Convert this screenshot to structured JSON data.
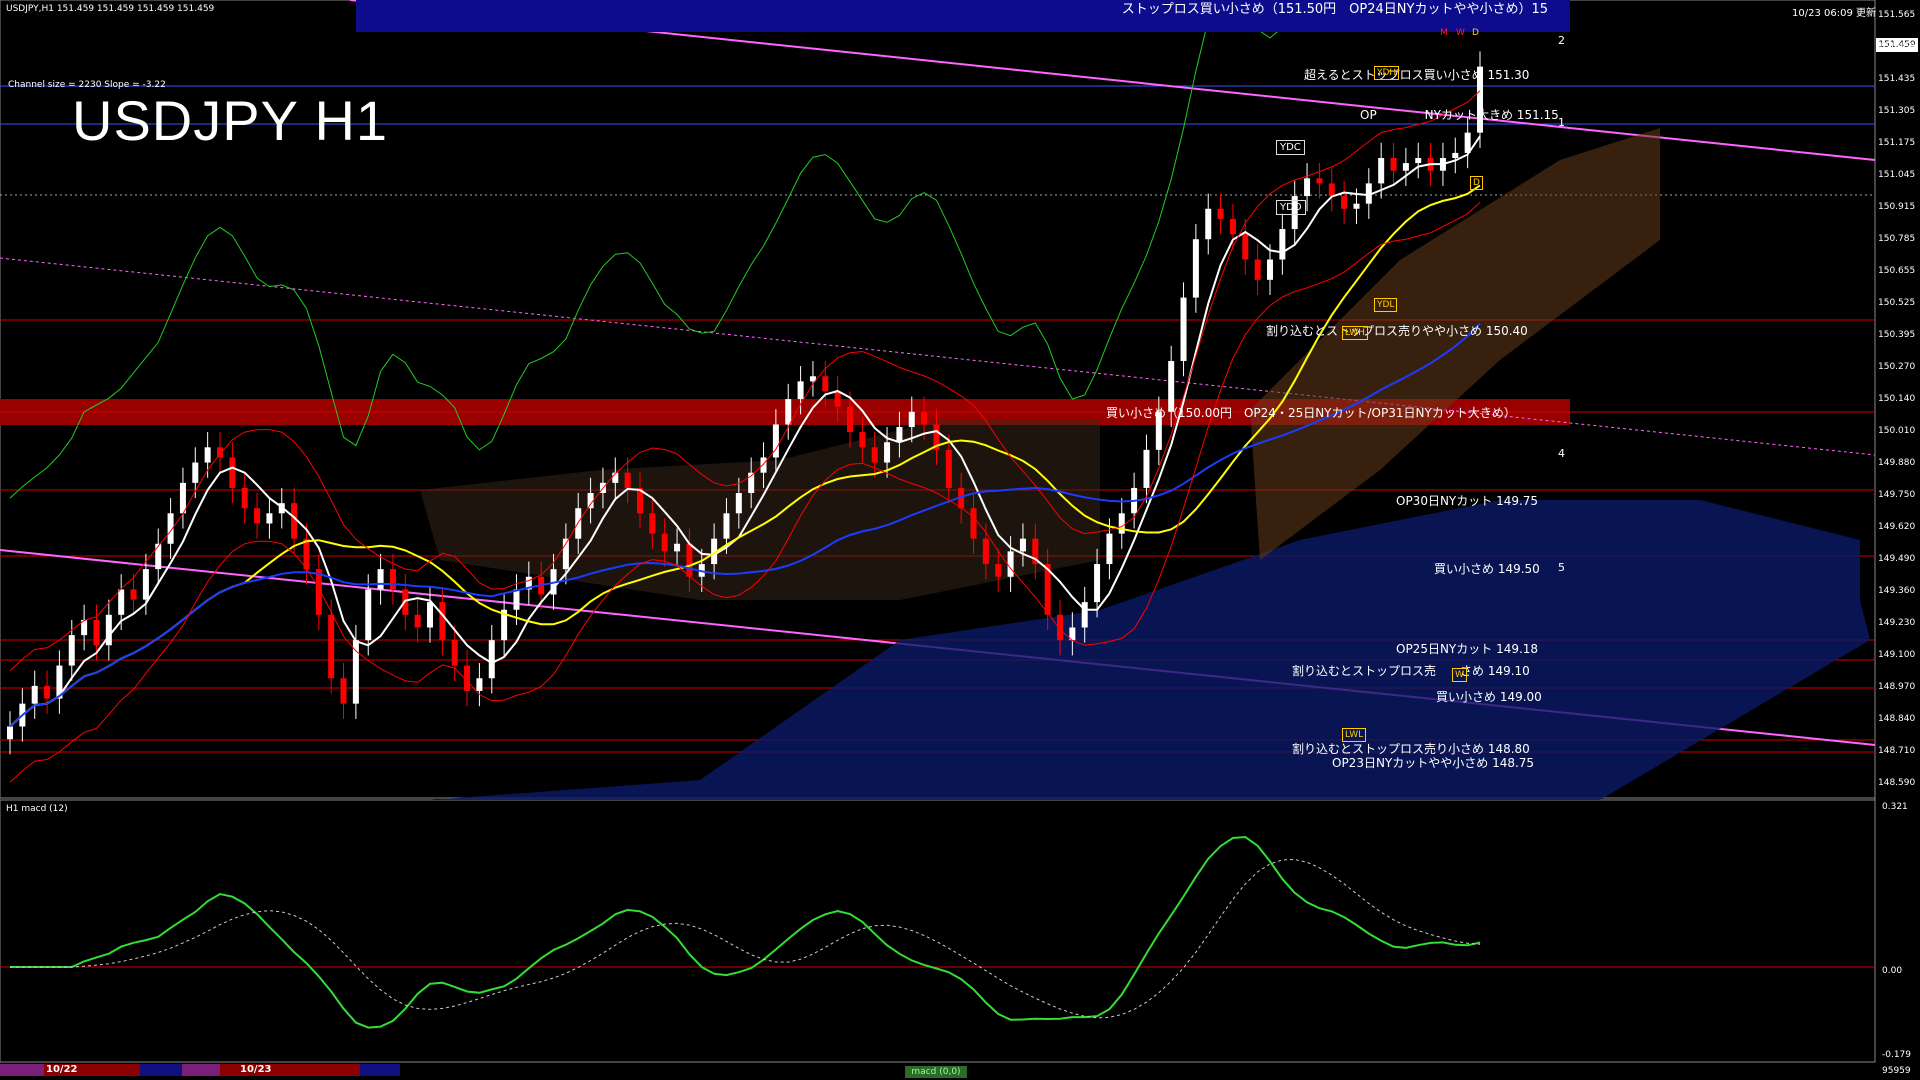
{
  "header": {
    "ohlc": "USDJPY,H1  151.459 151.459 151.459 151.459",
    "channel_info": "Channel size = 2230 Slope = -3.22",
    "big_title": "USDJPY H1",
    "timestamp": "10/23 06:09 更新"
  },
  "banner": {
    "text": "ストップロス買い小さめ（151.50円　OP24日NYカットやや小さめ）15"
  },
  "price_box": "151.459",
  "levels": [
    {
      "label": "超えるとストップロス買い小さめ 151.30"
    },
    {
      "label": "OP　　　　NYカット大きめ 151.15"
    },
    {
      "label": "割り込むとストップロス売りやや小さめ 150.40"
    },
    {
      "label": "買い小さめ（150.00円　OP24・25日NYカット/OP31日NYカット大きめ）"
    },
    {
      "label": "OP30日NYカット 149.75"
    },
    {
      "label": "買い小さめ 149.50"
    },
    {
      "label": "OP25日NYカット 149.18"
    },
    {
      "label": "割り込むとストップロス売　　さめ 149.10"
    },
    {
      "label": "買い小さめ 149.00"
    },
    {
      "label": "割り込むとストップロス売り小さめ 148.80"
    },
    {
      "label": "OP23日NYカットやや小さめ 148.75"
    }
  ],
  "yaxis_main": [
    "151.565",
    "151.459",
    "151.435",
    "151.305",
    "151.175",
    "151.045",
    "150.915",
    "150.785",
    "150.655",
    "150.525",
    "150.395",
    "150.270",
    "150.140",
    "150.010",
    "149.880",
    "149.750",
    "149.620",
    "149.490",
    "149.360",
    "149.230",
    "149.100",
    "148.970",
    "148.840",
    "148.710",
    "148.590"
  ],
  "yaxis_macd": [
    "0.321",
    "0.00",
    "-0.179",
    "95959"
  ],
  "macd_label": "H1 macd (12)",
  "wave_numbers": [
    "2",
    "1",
    "4",
    "5",
    "15"
  ],
  "box_labels": {
    "ydc1": "YDC",
    "ydc2": "YDO",
    "ydh": "YDH",
    "ydl": "YDL",
    "lwh": "LWH",
    "lwl": "LWL",
    "m": "M",
    "w": "W",
    "d": "D",
    "d2": "D",
    "w2": "W"
  },
  "dates": [
    "10/22",
    "10/23"
  ],
  "tabs": {
    "macd": "macd (0,0)"
  },
  "colors": {
    "bg": "#000000",
    "bull": "#ffffff",
    "bear": "#ff0000",
    "sma_white": "#ffffff",
    "sma_yellow": "#ffff00",
    "sma_blue": "#1a3cff",
    "green": "#22cc22",
    "magenta": "#ff66ff",
    "level_red": "#d00000",
    "banner_blue": "#0c0c8c",
    "band_red": "#990000"
  },
  "chart_data": {
    "type": "candlestick",
    "title": "USDJPY H1",
    "ylim": [
      148.59,
      151.565
    ],
    "candles_close": [
      148.86,
      148.95,
      149.02,
      148.97,
      149.1,
      149.22,
      149.28,
      149.18,
      149.3,
      149.4,
      149.36,
      149.48,
      149.58,
      149.7,
      149.82,
      149.9,
      149.96,
      149.92,
      149.8,
      149.72,
      149.66,
      149.7,
      149.74,
      149.6,
      149.48,
      149.3,
      149.05,
      148.95,
      149.2,
      149.4,
      149.48,
      149.4,
      149.3,
      149.25,
      149.35,
      149.2,
      149.1,
      149.0,
      149.05,
      149.2,
      149.32,
      149.4,
      149.45,
      149.38,
      149.48,
      149.6,
      149.72,
      149.78,
      149.82,
      149.86,
      149.8,
      149.7,
      149.62,
      149.55,
      149.58,
      149.45,
      149.5,
      149.6,
      149.7,
      149.78,
      149.86,
      149.92,
      150.05,
      150.15,
      150.22,
      150.24,
      150.18,
      150.12,
      150.02,
      149.96,
      149.9,
      149.98,
      150.04,
      150.1,
      150.05,
      149.95,
      149.8,
      149.72,
      149.6,
      149.5,
      149.45,
      149.55,
      149.6,
      149.5,
      149.3,
      149.2,
      149.25,
      149.35,
      149.5,
      149.62,
      149.7,
      149.8,
      149.95,
      150.1,
      150.3,
      150.55,
      150.78,
      150.9,
      150.86,
      150.8,
      150.7,
      150.62,
      150.7,
      150.82,
      150.95,
      151.02,
      151.0,
      150.95,
      150.9,
      150.92,
      151.0,
      151.1,
      151.05,
      151.08,
      151.1,
      151.05,
      151.1,
      151.12,
      151.2,
      151.46
    ]
  }
}
